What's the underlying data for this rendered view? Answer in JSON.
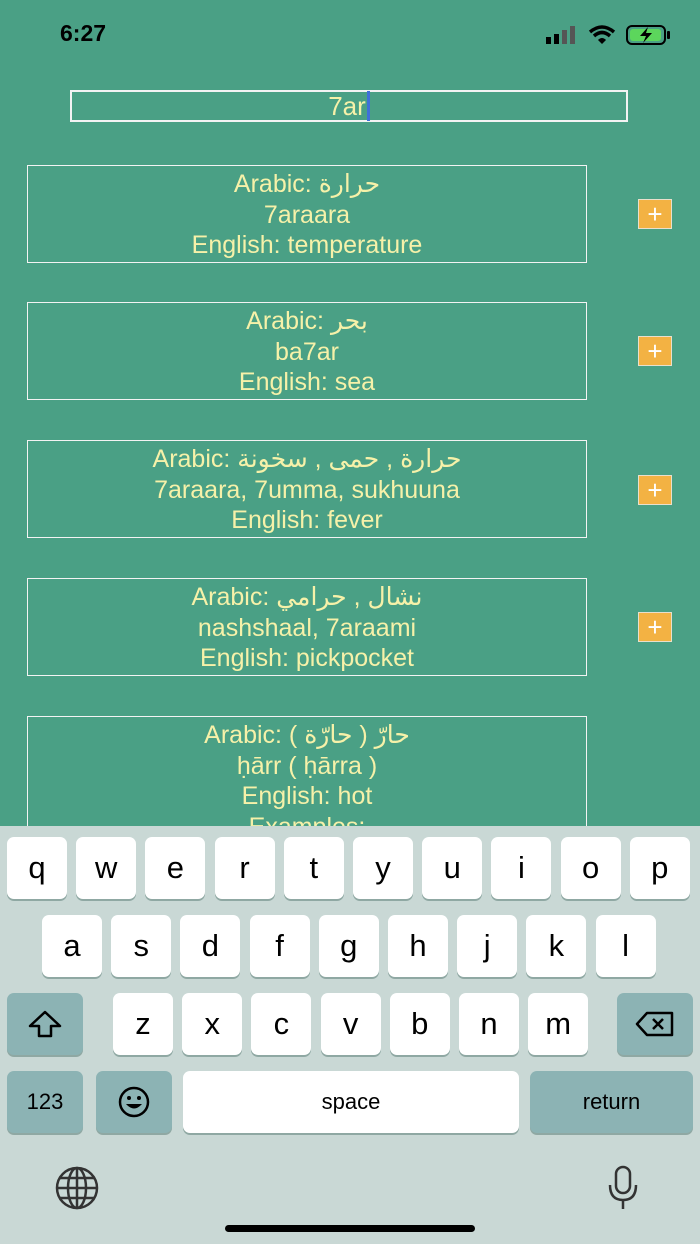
{
  "colors": {
    "background": "#4aa085",
    "text": "#f6f1a9",
    "add_button": "#f3b243",
    "keyboard_bg": "#c9d8d5",
    "key_fn": "#8cb3b4"
  },
  "status": {
    "time": "6:27"
  },
  "search": {
    "value": "7ar"
  },
  "results": [
    {
      "lines": [
        "Arabic:  حرارة",
        "7araara",
        "English: temperature"
      ],
      "add": "+"
    },
    {
      "lines": [
        "Arabic:  بحر",
        "ba7ar",
        "English: sea"
      ],
      "add": "+"
    },
    {
      "lines": [
        "Arabic:  حرارة ,  حمى ,  سخونة",
        "7araara, 7umma, sukhuuna",
        "English: fever"
      ],
      "add": "+"
    },
    {
      "lines": [
        "Arabic:  نشال ,  حرامي",
        "nashshaal, 7araami",
        "English: pickpocket"
      ],
      "add": "+"
    },
    {
      "lines": [
        "Arabic: ( حارّة )  حارّ",
        "ḥārr ( ḥārra )",
        "English: hot",
        "Examples:"
      ]
    }
  ],
  "keyboard": {
    "row1": [
      "q",
      "w",
      "e",
      "r",
      "t",
      "y",
      "u",
      "i",
      "o",
      "p"
    ],
    "row2": [
      "a",
      "s",
      "d",
      "f",
      "g",
      "h",
      "j",
      "k",
      "l"
    ],
    "row3": [
      "z",
      "x",
      "c",
      "v",
      "b",
      "n",
      "m"
    ],
    "numbers": "123",
    "space": "space",
    "return": "return",
    "icons": [
      "shift-icon",
      "backspace-icon",
      "emoji-icon",
      "globe-icon",
      "microphone-icon"
    ]
  }
}
